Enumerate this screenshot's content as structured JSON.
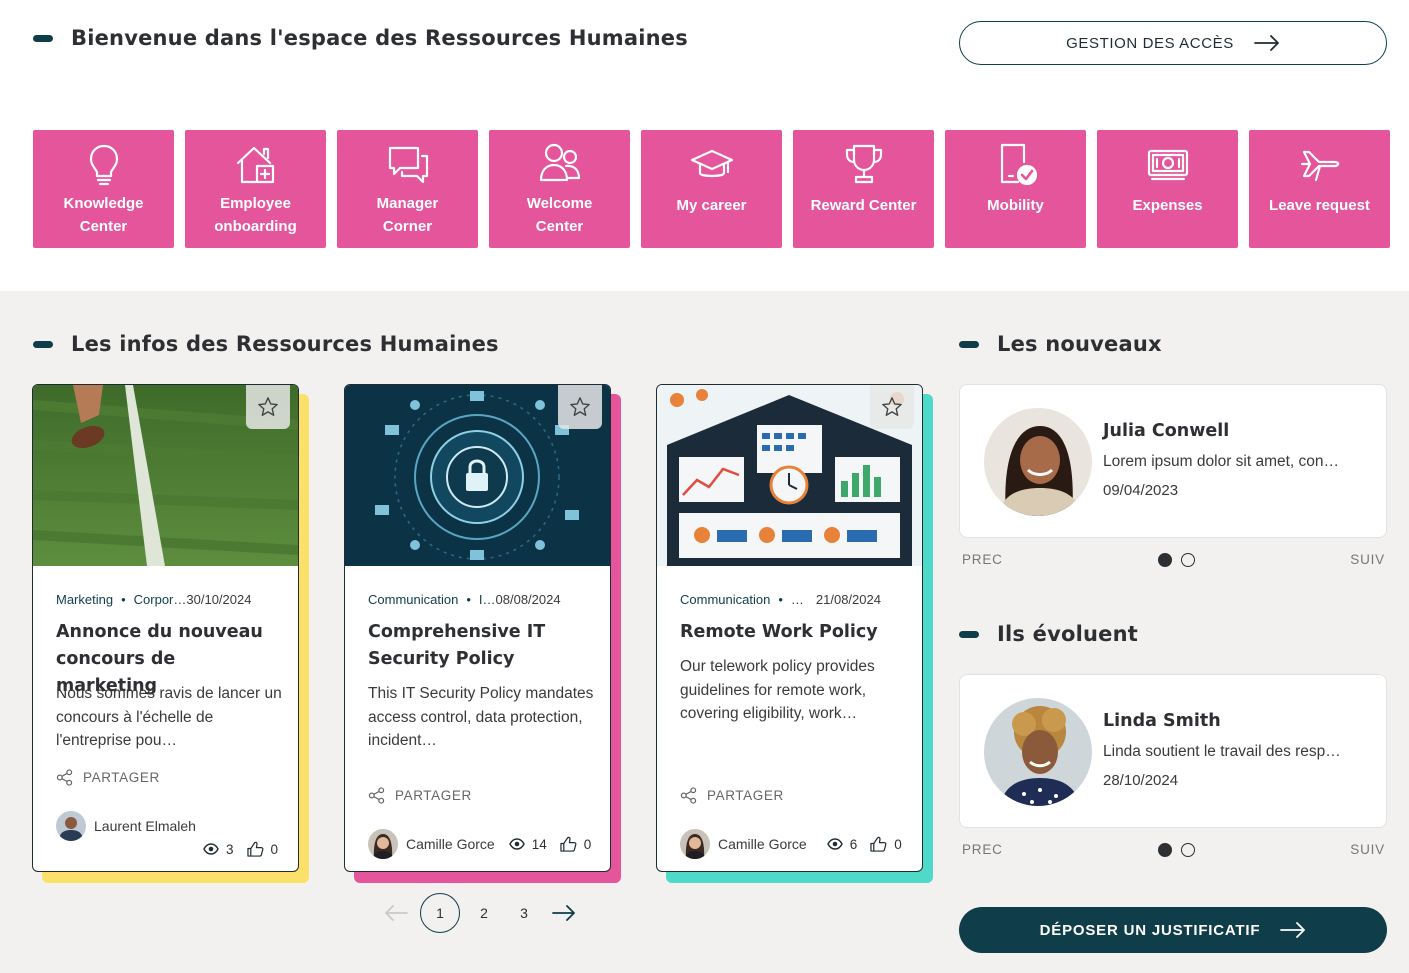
{
  "header": {
    "title": "Bienvenue dans l'espace des Ressources Humaines",
    "access_button": "GESTION DES ACCÈS"
  },
  "tiles": [
    {
      "line1": "Knowledge",
      "line2": "Center",
      "icon": "lightbulb-icon"
    },
    {
      "line1": "Employee",
      "line2": "onboarding",
      "icon": "house-icon"
    },
    {
      "line1": "Manager",
      "line2": "Corner",
      "icon": "chat-bubbles-icon"
    },
    {
      "line1": "Welcome",
      "line2": "Center",
      "icon": "people-icon"
    },
    {
      "line1": "My career",
      "line2": "",
      "icon": "graduation-cap-icon"
    },
    {
      "line1": "Reward Center",
      "line2": "",
      "icon": "trophy-icon"
    },
    {
      "line1": "Mobility",
      "line2": "",
      "icon": "mobile-check-icon"
    },
    {
      "line1": "Expenses",
      "line2": "",
      "icon": "banknote-icon"
    },
    {
      "line1": "Leave request",
      "line2": "",
      "icon": "airplane-icon"
    }
  ],
  "news": {
    "title": "Les infos des Ressources Humaines",
    "share_label": "PARTAGER",
    "cards": [
      {
        "category": "Marketing",
        "subcategory": "Corpor…",
        "date": "30/10/2024",
        "title": "Annonce du nouveau concours de marketing",
        "description": "Nous sommes ravis de lancer un concours à l'échelle de l'entreprise pou…",
        "author": "Laurent Elmaleh",
        "views": "3",
        "likes": "0",
        "accent": "#fbe06a"
      },
      {
        "category": "Communication",
        "subcategory": "I…",
        "date": "08/08/2024",
        "title": "Comprehensive IT Security Policy",
        "description": "This IT Security Policy mandates access control, data protection, incident…",
        "author": "Camille Gorce",
        "views": "14",
        "likes": "0",
        "accent": "#e4559b"
      },
      {
        "category": "Communication",
        "subcategory": "…",
        "date": "21/08/2024",
        "title": "Remote Work Policy",
        "description": "Our telework policy provides guidelines for remote work, covering eligibility, work…",
        "author": "Camille Gorce",
        "views": "6",
        "likes": "0",
        "accent": "#4fd9c8"
      }
    ],
    "pagination": [
      "1",
      "2",
      "3"
    ]
  },
  "newcomers": {
    "title": "Les nouveaux",
    "name": "Julia Conwell",
    "text": "Lorem ipsum dolor sit amet, con…",
    "date": "09/04/2023",
    "prev": "PREC",
    "next": "SUIV"
  },
  "promotions": {
    "title": "Ils évoluent",
    "name": "Linda Smith",
    "text": "Linda soutient le travail des resp…",
    "date": "28/10/2024",
    "prev": "PREC",
    "next": "SUIV"
  },
  "submit_button": "DÉPOSER UN JUSTIFICATIF"
}
